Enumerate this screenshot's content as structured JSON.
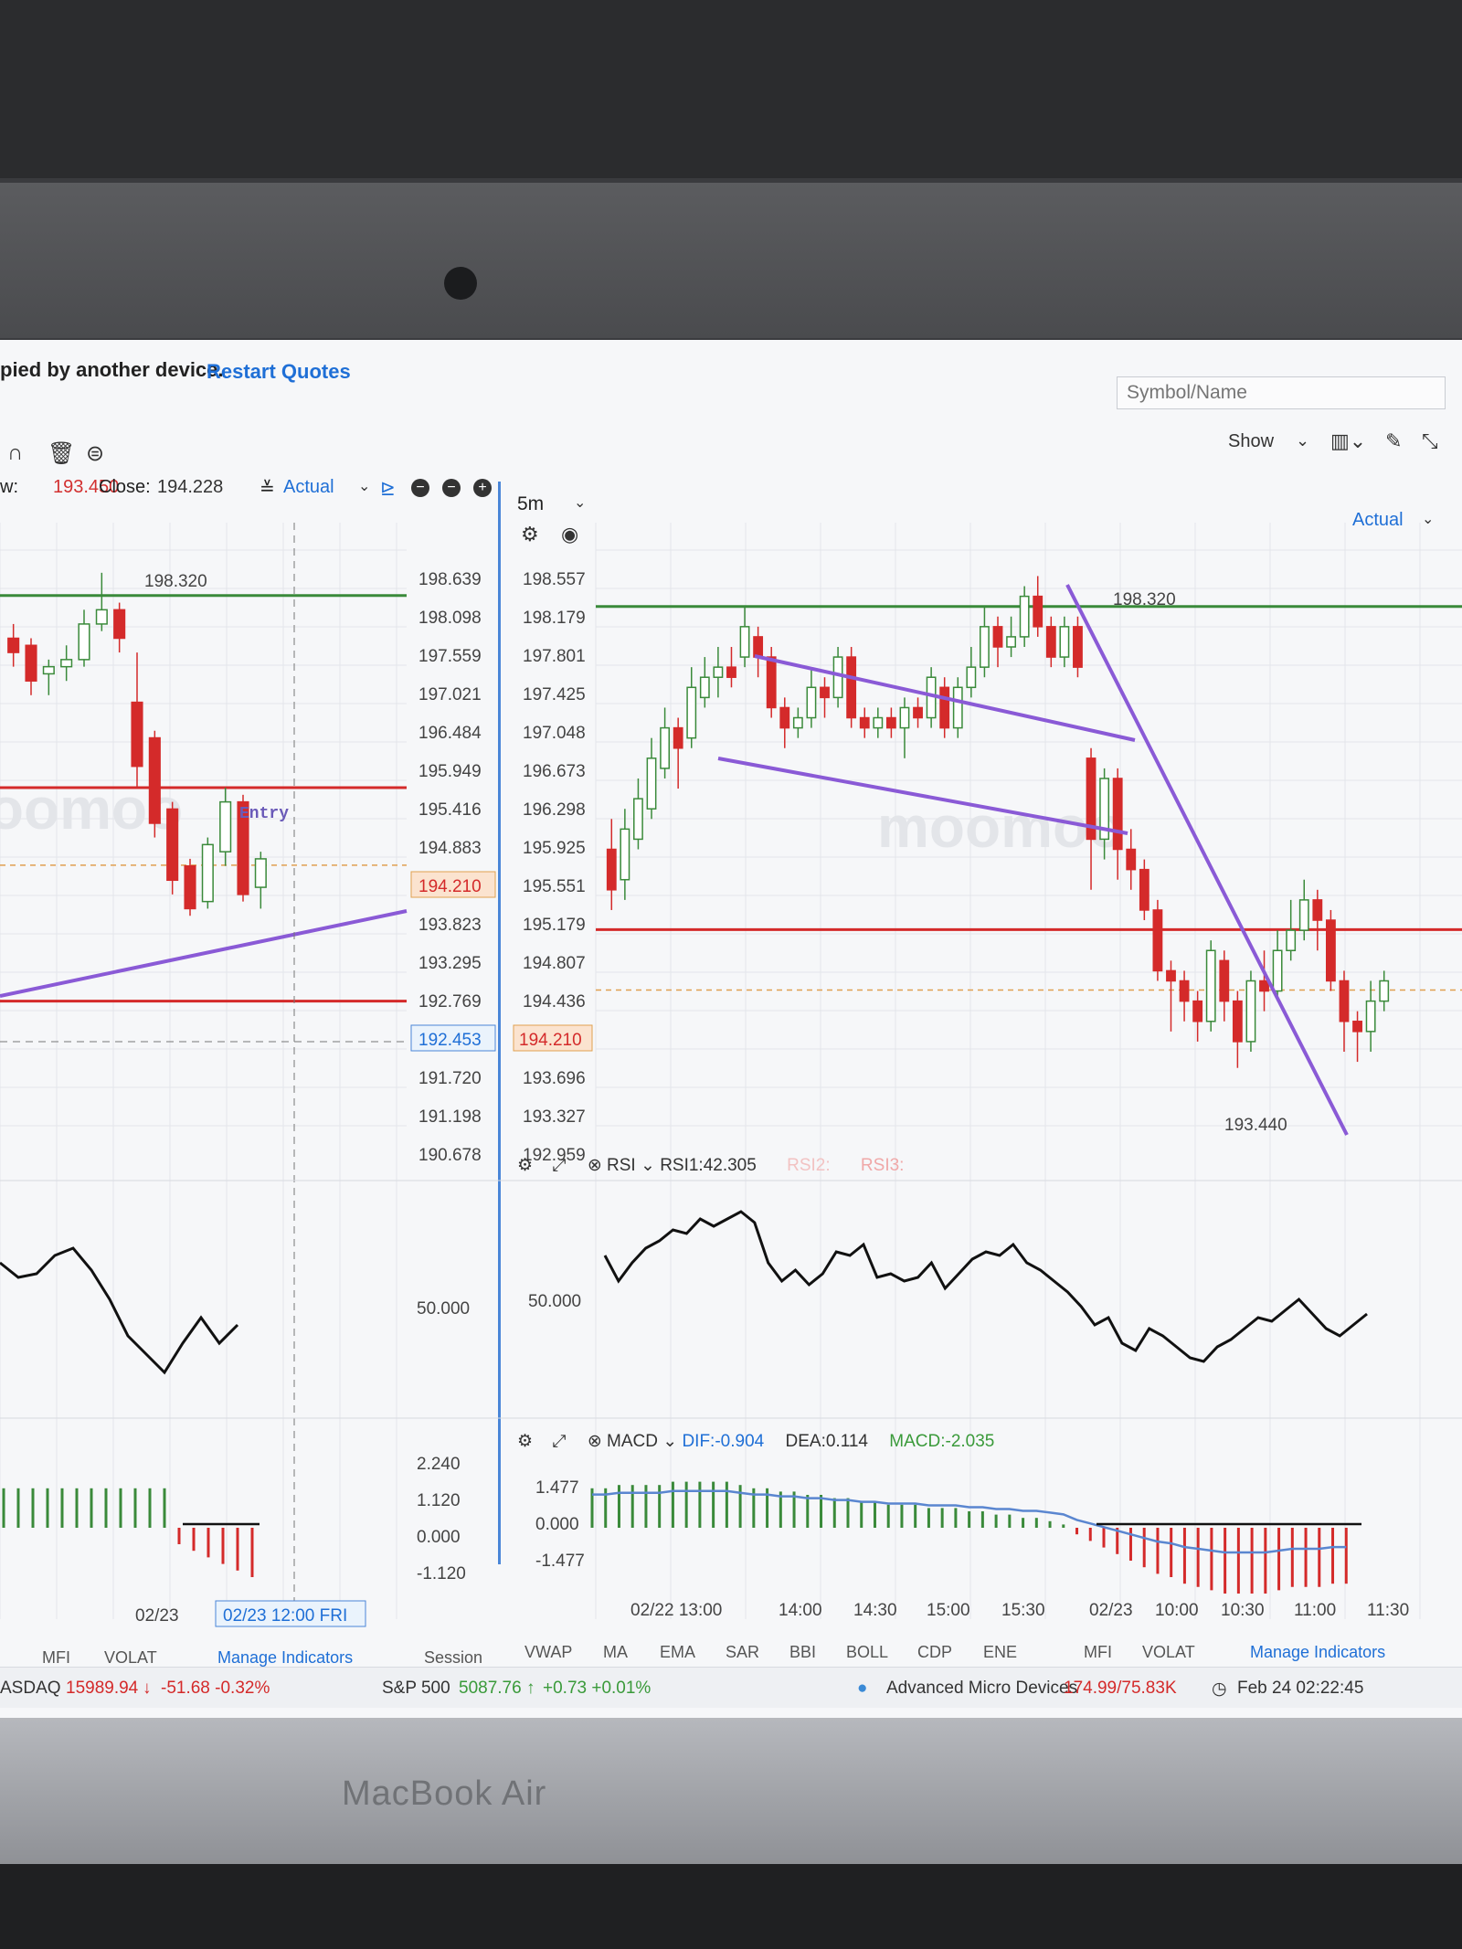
{
  "device_label": "MacBook Air",
  "app": {
    "notice": "pied by another device.",
    "restart_link": "Restart Quotes",
    "symbol_placeholder": "Symbol/Name",
    "show_label": "Show",
    "watermark": "moomoo"
  },
  "left_panel": {
    "low_label": "w:",
    "low_value": "193.450",
    "close_label": "Close:",
    "close_value": "194.228",
    "mode": "Actual",
    "high_marker": "198.320",
    "entry_label": "Entry",
    "price_ticks": [
      "198.639",
      "198.098",
      "197.559",
      "197.021",
      "196.484",
      "195.949",
      "195.416",
      "194.883",
      "194.210",
      "193.823",
      "193.295",
      "192.769",
      "192.453",
      "191.720",
      "191.198",
      "190.678"
    ],
    "current_price": "194.210",
    "crosshair_price": "192.453",
    "rsi_tick": "50.000",
    "macd_ticks": [
      "2.240",
      "1.120",
      "0.000",
      "-1.120"
    ],
    "date_label": "02/23",
    "crosshair_date": "02/23 12:00 FRI",
    "tabs": [
      "MFI",
      "VOLAT"
    ],
    "manage_indicators": "Manage Indicators",
    "session": "Session"
  },
  "right_panel": {
    "period": "5m",
    "mode": "Actual",
    "high_marker": "198.320",
    "low_marker": "193.440",
    "price_ticks": [
      "198.557",
      "198.179",
      "197.801",
      "197.425",
      "197.048",
      "196.673",
      "196.298",
      "195.925",
      "195.551",
      "195.179",
      "194.807",
      "194.436",
      "194.210",
      "193.696",
      "193.327",
      "192.959"
    ],
    "current_price": "194.210",
    "rsi": {
      "name": "RSI",
      "rsi1": "RSI1:42.305",
      "rsi2": "RSI2:",
      "rsi3": "RSI3:",
      "tick": "50.000"
    },
    "macd": {
      "name": "MACD",
      "dif": "DIF:-0.904",
      "dea": "DEA:0.114",
      "macd": "MACD:-2.035",
      "ticks": [
        "1.477",
        "0.000",
        "-1.477"
      ]
    },
    "time_ticks": [
      "02/22 13:00",
      "14:00",
      "14:30",
      "15:00",
      "15:30",
      "02/23",
      "10:00",
      "10:30",
      "11:00",
      "11:30"
    ],
    "tabs": [
      "VWAP",
      "MA",
      "EMA",
      "SAR",
      "BBI",
      "BOLL",
      "CDP",
      "ENE",
      "MFI",
      "VOLAT"
    ],
    "manage_indicators": "Manage Indicators"
  },
  "status_bar": {
    "nasdaq": "ASDAQ",
    "nasdaq_value": "15989.94",
    "nasdaq_change": "-51.68 -0.32%",
    "sp500": "S&P 500",
    "sp500_value": "5087.76",
    "sp500_change": "+0.73 +0.01%",
    "ticker_name": "Advanced Micro Devices",
    "ticker_value": "174.99/75.83K",
    "datetime": "Feb 24 02:22:45"
  },
  "colors": {
    "up": "#3a8a3a",
    "down": "#d42a2a",
    "trendline": "#8a5ad6",
    "accent": "#1f6fd6"
  },
  "chart_data": {
    "type": "candlestick",
    "period": "5m",
    "ylim": [
      192.959,
      198.557
    ],
    "candles": [
      {
        "o": 195.6,
        "c": 195.2,
        "h": 195.9,
        "l": 195.0
      },
      {
        "o": 195.3,
        "c": 195.8,
        "h": 196.0,
        "l": 195.1
      },
      {
        "o": 195.7,
        "c": 196.1,
        "h": 196.3,
        "l": 195.6
      },
      {
        "o": 196.0,
        "c": 196.5,
        "h": 196.7,
        "l": 195.9
      },
      {
        "o": 196.4,
        "c": 196.8,
        "h": 197.0,
        "l": 196.3
      },
      {
        "o": 196.8,
        "c": 196.6,
        "h": 196.9,
        "l": 196.2
      },
      {
        "o": 196.7,
        "c": 197.2,
        "h": 197.4,
        "l": 196.6
      },
      {
        "o": 197.1,
        "c": 197.3,
        "h": 197.5,
        "l": 197.0
      },
      {
        "o": 197.3,
        "c": 197.4,
        "h": 197.6,
        "l": 197.1
      },
      {
        "o": 197.4,
        "c": 197.3,
        "h": 197.6,
        "l": 197.2
      },
      {
        "o": 197.5,
        "c": 197.8,
        "h": 198.0,
        "l": 197.4
      },
      {
        "o": 197.7,
        "c": 197.5,
        "h": 197.8,
        "l": 197.3
      },
      {
        "o": 197.5,
        "c": 197.0,
        "h": 197.6,
        "l": 196.9
      },
      {
        "o": 197.0,
        "c": 196.8,
        "h": 197.1,
        "l": 196.6
      },
      {
        "o": 196.8,
        "c": 196.9,
        "h": 197.0,
        "l": 196.7
      },
      {
        "o": 196.9,
        "c": 197.2,
        "h": 197.4,
        "l": 196.8
      },
      {
        "o": 197.2,
        "c": 197.1,
        "h": 197.3,
        "l": 196.9
      },
      {
        "o": 197.1,
        "c": 197.5,
        "h": 197.6,
        "l": 197.0
      },
      {
        "o": 197.5,
        "c": 196.9,
        "h": 197.6,
        "l": 196.8
      },
      {
        "o": 196.9,
        "c": 196.8,
        "h": 197.0,
        "l": 196.7
      },
      {
        "o": 196.8,
        "c": 196.9,
        "h": 197.0,
        "l": 196.7
      },
      {
        "o": 196.9,
        "c": 196.8,
        "h": 197.0,
        "l": 196.7
      },
      {
        "o": 196.8,
        "c": 197.0,
        "h": 197.1,
        "l": 196.5
      },
      {
        "o": 197.0,
        "c": 196.9,
        "h": 197.1,
        "l": 196.8
      },
      {
        "o": 196.9,
        "c": 197.3,
        "h": 197.4,
        "l": 196.8
      },
      {
        "o": 197.2,
        "c": 196.8,
        "h": 197.3,
        "l": 196.7
      },
      {
        "o": 196.8,
        "c": 197.2,
        "h": 197.3,
        "l": 196.7
      },
      {
        "o": 197.2,
        "c": 197.4,
        "h": 197.6,
        "l": 197.1
      },
      {
        "o": 197.4,
        "c": 197.8,
        "h": 198.0,
        "l": 197.3
      },
      {
        "o": 197.8,
        "c": 197.6,
        "h": 197.9,
        "l": 197.4
      },
      {
        "o": 197.6,
        "c": 197.7,
        "h": 197.9,
        "l": 197.5
      },
      {
        "o": 197.7,
        "c": 198.1,
        "h": 198.2,
        "l": 197.6
      },
      {
        "o": 198.1,
        "c": 197.8,
        "h": 198.3,
        "l": 197.7
      },
      {
        "o": 197.8,
        "c": 197.5,
        "h": 197.9,
        "l": 197.4
      },
      {
        "o": 197.5,
        "c": 197.8,
        "h": 197.9,
        "l": 197.4
      },
      {
        "o": 197.8,
        "c": 197.4,
        "h": 197.9,
        "l": 197.3
      },
      {
        "o": 196.5,
        "c": 195.7,
        "h": 196.6,
        "l": 195.2
      },
      {
        "o": 195.7,
        "c": 196.3,
        "h": 196.4,
        "l": 195.5
      },
      {
        "o": 196.3,
        "c": 195.6,
        "h": 196.4,
        "l": 195.3
      },
      {
        "o": 195.6,
        "c": 195.4,
        "h": 195.8,
        "l": 195.2
      },
      {
        "o": 195.4,
        "c": 195.0,
        "h": 195.5,
        "l": 194.9
      },
      {
        "o": 195.0,
        "c": 194.4,
        "h": 195.1,
        "l": 194.3
      },
      {
        "o": 194.4,
        "c": 194.3,
        "h": 194.5,
        "l": 193.8
      },
      {
        "o": 194.3,
        "c": 194.1,
        "h": 194.4,
        "l": 193.9
      },
      {
        "o": 194.1,
        "c": 193.9,
        "h": 194.2,
        "l": 193.7
      },
      {
        "o": 193.9,
        "c": 194.6,
        "h": 194.7,
        "l": 193.8
      },
      {
        "o": 194.5,
        "c": 194.1,
        "h": 194.6,
        "l": 193.9
      },
      {
        "o": 194.1,
        "c": 193.7,
        "h": 194.2,
        "l": 193.44
      },
      {
        "o": 193.7,
        "c": 194.3,
        "h": 194.4,
        "l": 193.6
      },
      {
        "o": 194.3,
        "c": 194.2,
        "h": 194.6,
        "l": 194.0
      },
      {
        "o": 194.2,
        "c": 194.6,
        "h": 194.8,
        "l": 194.1
      },
      {
        "o": 194.6,
        "c": 194.8,
        "h": 195.1,
        "l": 194.5
      },
      {
        "o": 194.8,
        "c": 195.1,
        "h": 195.3,
        "l": 194.7
      },
      {
        "o": 195.1,
        "c": 194.9,
        "h": 195.2,
        "l": 194.6
      },
      {
        "o": 194.9,
        "c": 194.3,
        "h": 195.0,
        "l": 194.2
      },
      {
        "o": 194.3,
        "c": 193.9,
        "h": 194.4,
        "l": 193.6
      },
      {
        "o": 193.9,
        "c": 193.8,
        "h": 194.0,
        "l": 193.5
      },
      {
        "o": 193.8,
        "c": 194.1,
        "h": 194.3,
        "l": 193.6
      },
      {
        "o": 194.1,
        "c": 194.3,
        "h": 194.4,
        "l": 194.0
      }
    ],
    "horizontal_lines": [
      198.0,
      194.807
    ],
    "rsi": [
      62,
      55,
      60,
      64,
      66,
      69,
      68,
      72,
      70,
      72,
      74,
      71,
      60,
      55,
      58,
      54,
      57,
      63,
      62,
      65,
      56,
      57,
      55,
      56,
      60,
      53,
      57,
      61,
      63,
      62,
      65,
      60,
      58,
      55,
      52,
      48,
      43,
      45,
      38,
      36,
      42,
      40,
      37,
      34,
      33,
      37,
      39,
      42,
      45,
      44,
      47,
      50,
      46,
      42,
      40,
      43,
      46
    ],
    "macd_hist": [
      1.2,
      1.2,
      1.3,
      1.3,
      1.3,
      1.3,
      1.4,
      1.4,
      1.4,
      1.4,
      1.4,
      1.3,
      1.2,
      1.2,
      1.1,
      1.1,
      1.0,
      1.0,
      0.9,
      0.9,
      0.8,
      0.8,
      0.7,
      0.7,
      0.7,
      0.6,
      0.6,
      0.6,
      0.5,
      0.5,
      0.4,
      0.4,
      0.3,
      0.3,
      0.2,
      0.1,
      -0.2,
      -0.4,
      -0.6,
      -0.8,
      -1.0,
      -1.2,
      -1.4,
      -1.5,
      -1.7,
      -1.8,
      -1.9,
      -2.0,
      -2.0,
      -2.0,
      -2.0,
      -1.9,
      -1.8,
      -1.8,
      -1.8,
      -1.7,
      -1.7
    ],
    "left_candles": [
      {
        "o": 197.4,
        "c": 197.2,
        "h": 197.6,
        "l": 197.0
      },
      {
        "o": 197.3,
        "c": 196.8,
        "h": 197.4,
        "l": 196.6
      },
      {
        "o": 196.9,
        "c": 197.0,
        "h": 197.1,
        "l": 196.6
      },
      {
        "o": 197.0,
        "c": 197.1,
        "h": 197.3,
        "l": 196.8
      },
      {
        "o": 197.1,
        "c": 197.6,
        "h": 197.8,
        "l": 197.0
      },
      {
        "o": 197.6,
        "c": 197.8,
        "h": 198.32,
        "l": 197.5
      },
      {
        "o": 197.8,
        "c": 197.4,
        "h": 197.9,
        "l": 197.2
      },
      {
        "o": 196.5,
        "c": 195.6,
        "h": 197.2,
        "l": 195.3
      },
      {
        "o": 196.0,
        "c": 194.8,
        "h": 196.1,
        "l": 194.6
      },
      {
        "o": 195.0,
        "c": 194.0,
        "h": 195.1,
        "l": 193.8
      },
      {
        "o": 194.2,
        "c": 193.6,
        "h": 194.3,
        "l": 193.5
      },
      {
        "o": 193.7,
        "c": 194.5,
        "h": 194.6,
        "l": 193.6
      },
      {
        "o": 194.4,
        "c": 195.1,
        "h": 195.3,
        "l": 194.2
      },
      {
        "o": 195.1,
        "c": 193.8,
        "h": 195.2,
        "l": 193.7
      },
      {
        "o": 193.9,
        "c": 194.3,
        "h": 194.4,
        "l": 193.6
      }
    ]
  }
}
